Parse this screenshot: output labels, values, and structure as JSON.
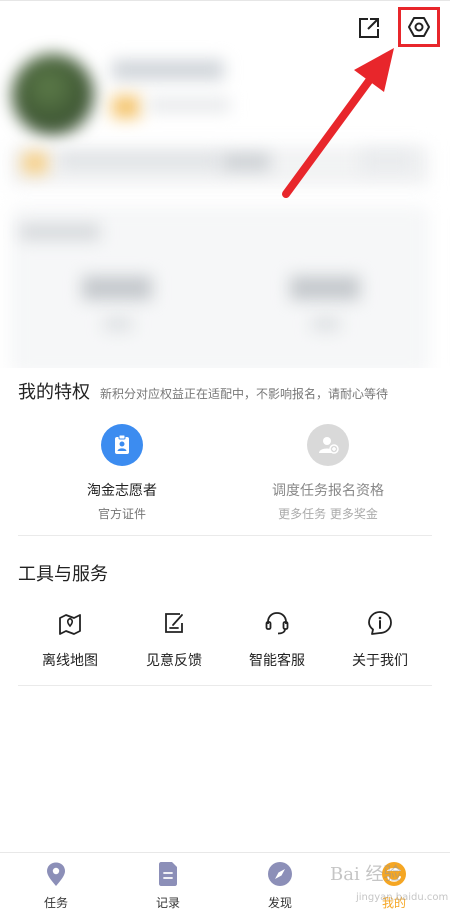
{
  "privileges": {
    "title": "我的特权",
    "subtitle": "新积分对应权益正在适配中，不影响报名，请耐心等待",
    "items": [
      {
        "label": "淘金志愿者",
        "sub": "官方证件",
        "icon": "id-badge-icon",
        "color": "#3c8cf0"
      },
      {
        "label": "调度任务报名资格",
        "sub": "更多任务 更多奖金",
        "icon": "user-add-icon",
        "color": "#d9d9d9"
      }
    ]
  },
  "tools": {
    "title": "工具与服务",
    "items": [
      {
        "label": "离线地图",
        "icon": "map-pin-icon"
      },
      {
        "label": "见意反馈",
        "icon": "feedback-icon"
      },
      {
        "label": "智能客服",
        "icon": "headset-icon"
      },
      {
        "label": "关于我们",
        "icon": "info-icon"
      }
    ]
  },
  "tabbar": {
    "items": [
      {
        "label": "任务",
        "icon": "location-icon"
      },
      {
        "label": "记录",
        "icon": "document-icon"
      },
      {
        "label": "发现",
        "icon": "compass-icon"
      },
      {
        "label": "我的",
        "icon": "profile-icon",
        "active": true
      }
    ]
  },
  "watermark": {
    "text": "Bai 经验",
    "sub": "jingyan.baidu.com"
  },
  "colors": {
    "accent": "#f5a623",
    "highlight": "#e8262b",
    "primary": "#3c8cf0"
  }
}
